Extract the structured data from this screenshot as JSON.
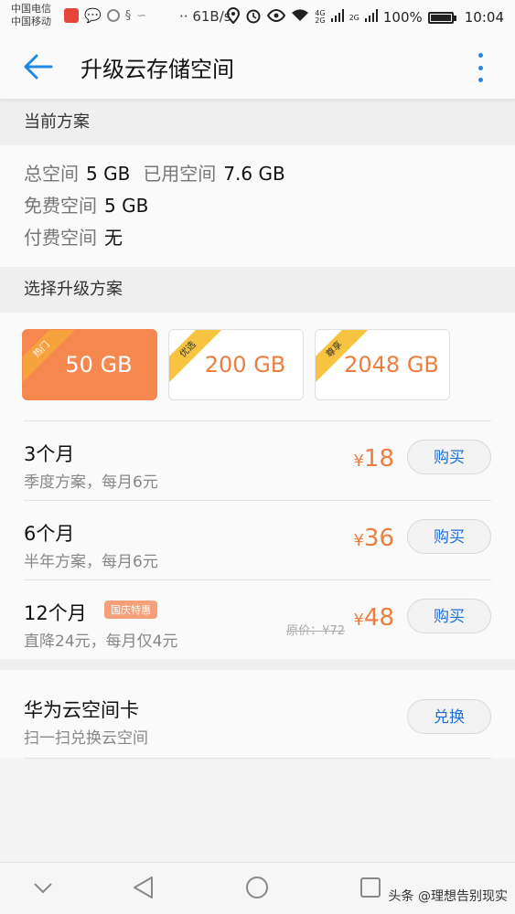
{
  "status_bar": {
    "carrier1": "中国电信",
    "carrier2": "中国移动",
    "speed": "61B/s",
    "net1": "4G",
    "net2": "2G",
    "net3": "2G",
    "battery": "100%",
    "time": "10:04"
  },
  "appbar": {
    "title": "升级云存储空间"
  },
  "current": {
    "header": "当前方案",
    "total_label": "总空间",
    "total_value": "5 GB",
    "used_label": "已用空间",
    "used_value": "7.6 GB",
    "free_label": "免费空间",
    "free_value": "5 GB",
    "paid_label": "付费空间",
    "paid_value": "无"
  },
  "upgrade": {
    "header": "选择升级方案",
    "plans": [
      {
        "tag": "热门",
        "size": "50 GB",
        "selected": true
      },
      {
        "tag": "优选",
        "size": "200 GB",
        "selected": false
      },
      {
        "tag": "尊享",
        "size": "2048 GB",
        "selected": false
      }
    ],
    "options": [
      {
        "name": "3个月",
        "desc": "季度方案，每月6元",
        "price": "18",
        "button": "购买"
      },
      {
        "name": "6个月",
        "desc": "半年方案，每月6元",
        "price": "36",
        "button": "购买"
      },
      {
        "name": "12个月",
        "badge": "国庆特惠",
        "desc": "直降24元，每月仅4元",
        "original": "原价：¥72",
        "price": "48",
        "button": "购买"
      }
    ],
    "currency": "¥"
  },
  "card": {
    "name": "华为云空间卡",
    "desc": "扫一扫兑换云空间",
    "button": "兑换"
  },
  "watermark": "头条 @理想告别现实",
  "colors": {
    "accent_blue": "#1e88e5",
    "price_orange": "#ee7d40",
    "selected_plan": "#f5874f"
  }
}
